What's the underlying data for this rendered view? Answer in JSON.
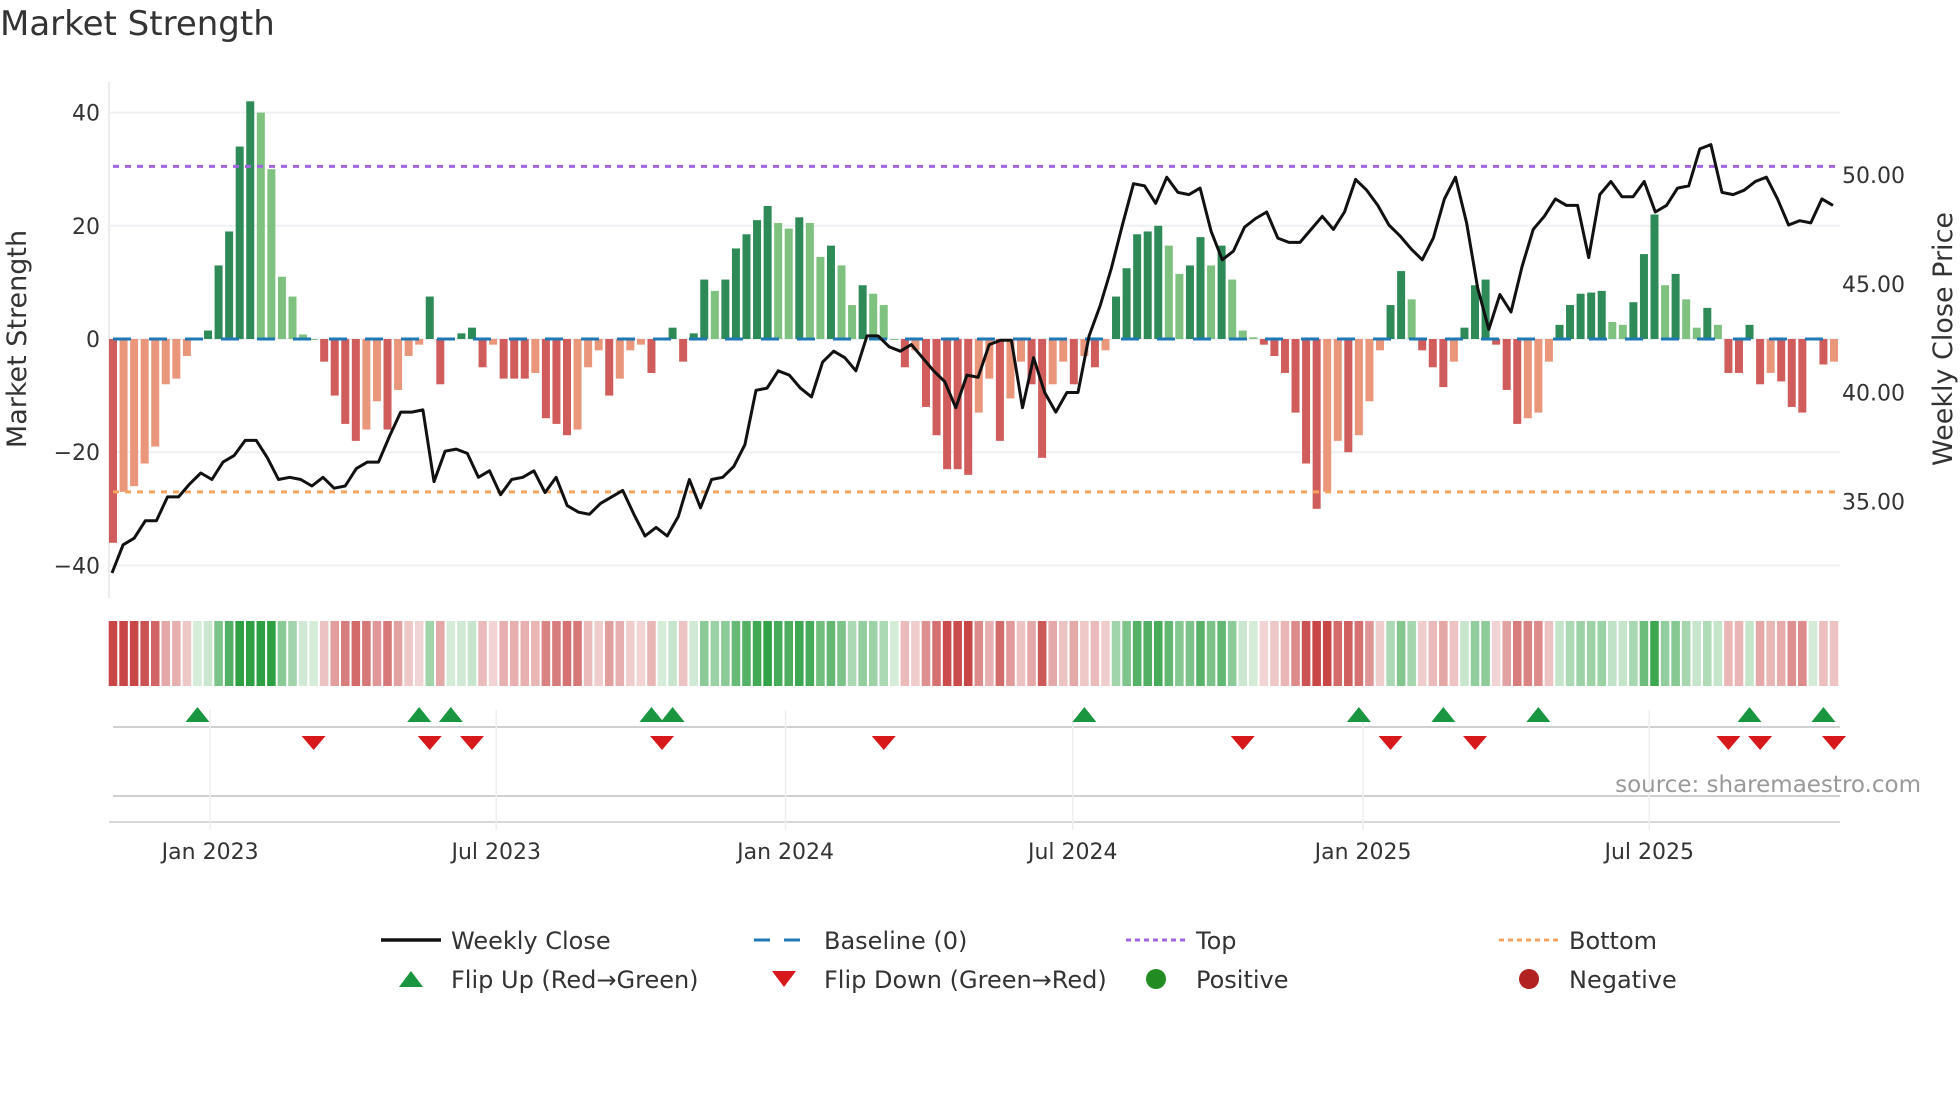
{
  "title": "Market Strength",
  "source": "source: sharemaestro.com",
  "colors": {
    "pos_dark": "#2e8b57",
    "pos_light": "#7fc17f",
    "neg_dark": "#d05c5c",
    "neg_light": "#e9967a",
    "baseline": "#1f77b4",
    "top": "#a066e0",
    "bottom": "#f4a460",
    "close": "#111111",
    "flip_up": "#1a9641",
    "flip_down": "#d7191c",
    "positive": "#228b22",
    "negative": "#b22222"
  },
  "chart_data": {
    "type": "bar",
    "title": "Market Strength",
    "ylabel": "Market Strength",
    "y2label": "Weekly Close Price",
    "ylim": [
      -44,
      44
    ],
    "y2lim": [
      31,
      54.5
    ],
    "yticks": [
      "40",
      "20",
      "0",
      "−20",
      "−40"
    ],
    "ytick_values": [
      40,
      20,
      0,
      -20,
      -40
    ],
    "y2ticks": [
      "50.00",
      "45.00",
      "40.00",
      "35.00"
    ],
    "y2tick_values": [
      50,
      45,
      40,
      35
    ],
    "xticks": [
      {
        "label": "Jan 2023",
        "week": 9.2
      },
      {
        "label": "Jul 2023",
        "week": 36.3
      },
      {
        "label": "Jan 2024",
        "week": 63.7
      },
      {
        "label": "Jul 2024",
        "week": 90.9
      },
      {
        "label": "Jan 2025",
        "week": 118.4
      },
      {
        "label": "Jul 2025",
        "week": 145.5
      }
    ],
    "top_level": 30.5,
    "bottom_level": -27,
    "baseline": 0,
    "strength": [
      -36,
      -27,
      -26,
      -22,
      -19,
      -8,
      -7,
      -3,
      0,
      1.5,
      13,
      19,
      34,
      42,
      40,
      30,
      11,
      7.5,
      0.8,
      0,
      -4,
      -10,
      -15,
      -18,
      -16,
      -11,
      -16,
      -9,
      -3,
      -1,
      7.5,
      -8,
      0,
      1,
      2,
      -5,
      -1,
      -7,
      -7,
      -7,
      -6,
      -14,
      -15,
      -17,
      -16,
      -5,
      -2,
      -10,
      -7,
      -2,
      -1,
      -6,
      0,
      2,
      -4,
      1,
      10.5,
      8.5,
      10.5,
      16,
      18.5,
      21,
      23.5,
      20.5,
      19.5,
      21.5,
      20.5,
      14.5,
      16.5,
      13,
      6,
      9.5,
      8,
      6,
      0,
      -5,
      -2,
      -12,
      -17,
      -23,
      -23,
      -24,
      -13,
      -7,
      -18,
      -10.5,
      -4,
      -8,
      -21,
      -8,
      -4,
      -8,
      -3,
      -5,
      -2,
      7.5,
      12.5,
      18.5,
      19,
      20,
      16.5,
      11.5,
      13,
      18,
      13,
      16.5,
      10.5,
      1.5,
      0.3,
      -1,
      -3,
      -6,
      -13,
      -22,
      -30,
      -27,
      -18,
      -20,
      -17,
      -11,
      -2,
      6,
      12,
      7,
      -2,
      -5,
      -8.5,
      -4,
      2,
      9.5,
      10.5,
      -1,
      -9,
      -15,
      -14,
      -13,
      -4,
      2.5,
      6,
      8,
      8.2,
      8.5,
      3,
      2.5,
      6.5,
      15,
      22,
      9.5,
      11.5,
      7,
      2,
      5.5,
      2.5,
      -6,
      -6,
      2.5,
      -8,
      -6,
      -7.5,
      -12,
      -13,
      0.2,
      -4.5,
      -4
    ],
    "weekly_close": [
      31.7,
      33.0,
      33.3,
      34.1,
      34.1,
      35.2,
      35.2,
      35.8,
      36.3,
      36.0,
      36.8,
      37.1,
      37.8,
      37.8,
      37.0,
      36.0,
      36.1,
      36.0,
      35.7,
      36.1,
      35.6,
      35.7,
      36.5,
      36.8,
      36.8,
      38.0,
      39.1,
      39.1,
      39.2,
      35.9,
      37.3,
      37.4,
      37.2,
      36.1,
      36.4,
      35.3,
      36.0,
      36.1,
      36.4,
      35.4,
      36.1,
      34.8,
      34.5,
      34.4,
      34.9,
      35.2,
      35.5,
      34.4,
      33.4,
      33.8,
      33.4,
      34.3,
      36.0,
      34.7,
      36.0,
      36.1,
      36.6,
      37.6,
      40.1,
      40.2,
      41.0,
      40.8,
      40.2,
      39.8,
      41.4,
      41.9,
      41.6,
      41.0,
      42.6,
      42.6,
      42.1,
      41.9,
      42.2,
      41.6,
      41.0,
      40.5,
      39.3,
      40.8,
      40.7,
      42.2,
      42.4,
      42.4,
      39.3,
      41.6,
      40.0,
      39.1,
      40.0,
      40.0,
      42.6,
      44.0,
      45.7,
      47.7,
      49.6,
      49.5,
      48.7,
      49.9,
      49.2,
      49.1,
      49.4,
      47.4,
      46.1,
      46.5,
      47.6,
      48.0,
      48.3,
      47.1,
      46.9,
      46.9,
      47.5,
      48.1,
      47.5,
      48.3,
      49.8,
      49.3,
      48.6,
      47.7,
      47.2,
      46.6,
      46.1,
      47.1,
      48.9,
      49.9,
      47.8,
      44.8,
      42.9,
      44.5,
      43.7,
      45.8,
      47.5,
      48.1,
      48.9,
      48.6,
      48.6,
      46.2,
      49.1,
      49.7,
      49.0,
      49.0,
      49.7,
      48.3,
      48.6,
      49.4,
      49.5,
      51.2,
      51.4,
      49.2,
      49.1,
      49.3,
      49.7,
      49.9,
      48.9,
      47.7,
      47.9,
      47.8,
      48.9,
      48.6
    ],
    "flip_up_weeks": [
      8,
      29,
      32,
      51,
      53,
      92,
      118,
      126,
      135,
      155,
      162
    ],
    "flip_down_weeks": [
      19,
      30,
      34,
      52,
      73,
      107,
      121,
      129,
      153,
      156,
      163
    ],
    "legend": [
      {
        "label": "Weekly Close",
        "kind": "line"
      },
      {
        "label": "Baseline (0)",
        "kind": "dash"
      },
      {
        "label": "Top",
        "kind": "dot-top"
      },
      {
        "label": "Bottom",
        "kind": "dot-bottom"
      },
      {
        "label": "Flip Up (Red→Green)",
        "kind": "tri-up"
      },
      {
        "label": "Flip Down (Green→Red)",
        "kind": "tri-down"
      },
      {
        "label": "Positive",
        "kind": "dot-pos"
      },
      {
        "label": "Negative",
        "kind": "dot-neg"
      }
    ],
    "legend_position": "bottom"
  }
}
